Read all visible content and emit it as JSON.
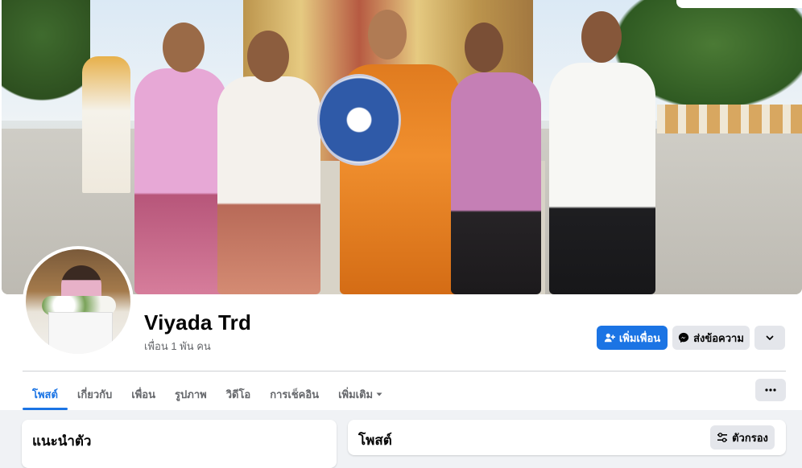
{
  "profile": {
    "name": "Viyada Trd",
    "friends": "เพื่อน 1 พัน คน"
  },
  "actions": {
    "add_friend": "เพิ่มเพื่อน",
    "message": "ส่งข้อความ"
  },
  "tabs": [
    {
      "label": "โพสต์",
      "active": true
    },
    {
      "label": "เกี่ยวกับ"
    },
    {
      "label": "เพื่อน"
    },
    {
      "label": "รูปภาพ"
    },
    {
      "label": "วิดีโอ"
    },
    {
      "label": "การเช็คอิน"
    },
    {
      "label": "เพิ่มเติม"
    }
  ],
  "intro": {
    "title": "แนะนำตัว"
  },
  "posts": {
    "title": "โพสต์",
    "filter": "ตัวกรอง"
  },
  "colors": {
    "primary": "#1b74e4",
    "secondary_button": "#e4e6eb",
    "page_background": "#f0f2f5"
  },
  "icons": [
    "add-friend-icon",
    "messenger-icon",
    "chevron-down-icon",
    "more-icon",
    "filter-icon"
  ]
}
